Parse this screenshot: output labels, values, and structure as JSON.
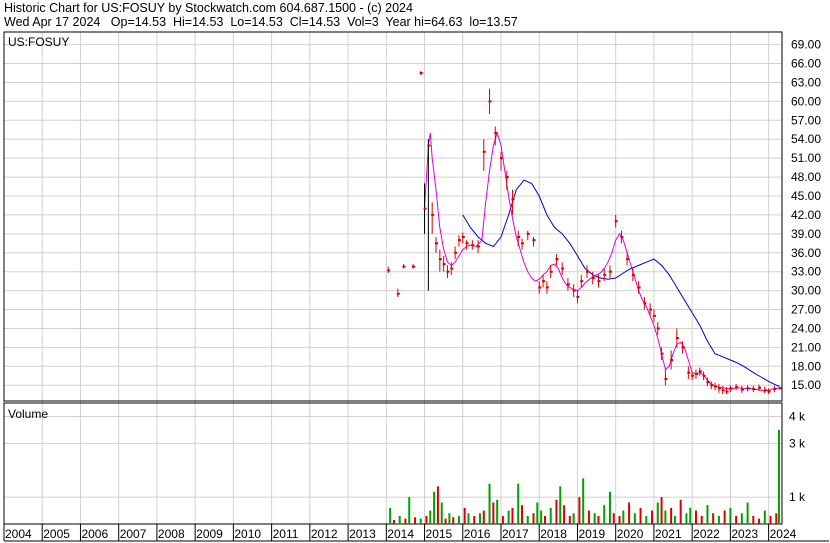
{
  "header": {
    "line1": "Historic Chart for US:FOSUY by Stockwatch.com 604.687.1500 - (c) 2024",
    "line2": "Wed Apr 17 2024   Op=14.53  Hi=14.53  Lo=14.53  Cl=14.53  Vol=3  Year hi=64.63  lo=13.57"
  },
  "colors": {
    "price_bar": "#dd0000",
    "ma_short": "#e000e0",
    "ma_long": "#0000cc",
    "vol_up": "#00a000",
    "vol_down": "#dd0000",
    "grid": "#d0d0d0"
  },
  "chart_data": [
    {
      "type": "line",
      "title": "US:FOSUY",
      "ylim": [
        12.5,
        71
      ],
      "ytick_labels": [
        "69.00",
        "66.00",
        "63.00",
        "60.00",
        "57.00",
        "54.00",
        "51.00",
        "48.00",
        "45.00",
        "42.00",
        "39.00",
        "36.00",
        "33.00",
        "30.00",
        "27.00",
        "24.00",
        "21.00",
        "18.00",
        "15.00"
      ],
      "x_labels": [
        "2004",
        "2005",
        "2006",
        "2007",
        "2008",
        "2009",
        "2010",
        "2011",
        "2012",
        "2013",
        "2014",
        "2015",
        "2016",
        "2017",
        "2018",
        "2019",
        "2020",
        "2021",
        "2022",
        "2023",
        "2024"
      ],
      "price": {
        "t": [
          2014.05,
          2014.3,
          2014.45,
          2014.7,
          2014.9,
          2015.0,
          2015.1,
          2015.2,
          2015.3,
          2015.4,
          2015.5,
          2015.6,
          2015.7,
          2015.8,
          2015.9,
          2016.0,
          2016.1,
          2016.25,
          2016.4,
          2016.55,
          2016.7,
          2016.85,
          2017.0,
          2017.15,
          2017.3,
          2017.45,
          2017.55,
          2017.7,
          2017.85,
          2018.0,
          2018.1,
          2018.2,
          2018.3,
          2018.45,
          2018.6,
          2018.75,
          2018.9,
          2019.0,
          2019.1,
          2019.25,
          2019.4,
          2019.55,
          2019.7,
          2019.85,
          2020.0,
          2020.15,
          2020.3,
          2020.45,
          2020.6,
          2020.75,
          2020.9,
          2021.0,
          2021.1,
          2021.2,
          2021.3,
          2021.45,
          2021.6,
          2021.75,
          2021.9,
          2022.0,
          2022.1,
          2022.2,
          2022.3,
          2022.4,
          2022.5,
          2022.6,
          2022.7,
          2022.8,
          2022.9,
          2023.0,
          2023.15,
          2023.3,
          2023.45,
          2023.6,
          2023.75,
          2023.9,
          2024.0,
          2024.15,
          2024.29
        ],
        "close": [
          33.2,
          29.5,
          33.8,
          33.8,
          64.5,
          43.0,
          53.0,
          42.0,
          37.5,
          35.0,
          34.2,
          33.0,
          33.5,
          36.0,
          38.0,
          38.5,
          37.5,
          37.2,
          37.0,
          52.0,
          60.0,
          55.0,
          51.0,
          48.0,
          44.5,
          38.5,
          37.5,
          39.0,
          38.0,
          30.5,
          31.5,
          30.5,
          33.0,
          35.0,
          33.5,
          31.0,
          30.0,
          29.0,
          31.5,
          33.0,
          32.0,
          31.5,
          32.5,
          33.0,
          41.0,
          38.5,
          35.0,
          32.5,
          30.5,
          28.0,
          27.0,
          26.0,
          24.0,
          20.0,
          16.0,
          19.0,
          22.5,
          21.0,
          17.0,
          16.5,
          16.8,
          17.2,
          16.5,
          15.5,
          15.0,
          14.8,
          14.5,
          14.2,
          14.0,
          14.5,
          14.7,
          14.3,
          14.5,
          14.4,
          14.6,
          14.2,
          14.0,
          14.4,
          14.53
        ],
        "high": [
          33.8,
          30.3,
          34.2,
          34.2,
          64.8,
          47.0,
          54.0,
          44.0,
          38.5,
          36.5,
          35.5,
          34.0,
          34.5,
          37.0,
          38.8,
          39.2,
          38.0,
          38.0,
          38.0,
          54.0,
          62.0,
          56.0,
          52.0,
          49.0,
          46.0,
          39.5,
          38.2,
          39.5,
          38.5,
          31.5,
          32.5,
          31.5,
          34.0,
          35.8,
          34.5,
          32.0,
          31.0,
          30.0,
          32.5,
          34.0,
          33.0,
          32.5,
          33.5,
          34.0,
          42.0,
          39.5,
          36.0,
          33.5,
          31.5,
          29.0,
          28.0,
          27.0,
          25.0,
          21.0,
          17.5,
          20.5,
          24.0,
          22.0,
          18.0,
          17.2,
          17.5,
          17.8,
          17.2,
          16.2,
          15.6,
          15.4,
          15.2,
          14.9,
          14.7,
          15.0,
          15.2,
          14.9,
          15.0,
          14.9,
          15.1,
          14.8,
          14.5,
          14.9,
          14.53
        ],
        "low": [
          32.8,
          29.0,
          33.5,
          33.5,
          64.2,
          39.0,
          30.0,
          39.0,
          36.0,
          33.0,
          33.0,
          32.0,
          32.5,
          35.0,
          37.0,
          37.5,
          36.5,
          36.5,
          36.0,
          49.0,
          58.0,
          53.0,
          49.0,
          46.0,
          42.0,
          37.0,
          36.5,
          38.0,
          37.0,
          29.5,
          30.5,
          29.5,
          32.0,
          34.0,
          32.5,
          30.0,
          29.0,
          28.0,
          30.5,
          32.0,
          31.0,
          30.5,
          31.5,
          32.0,
          40.0,
          37.5,
          34.0,
          31.5,
          29.5,
          27.0,
          26.0,
          25.0,
          23.0,
          19.0,
          15.0,
          17.5,
          21.0,
          20.0,
          16.0,
          15.8,
          16.0,
          16.5,
          15.8,
          14.9,
          14.4,
          14.2,
          13.8,
          13.6,
          13.57,
          13.9,
          14.2,
          13.8,
          14.0,
          13.9,
          14.1,
          13.7,
          13.6,
          13.9,
          14.53
        ]
      },
      "ma_short": {
        "t": [
          2015.0,
          2015.1,
          2015.15,
          2015.2,
          2015.3,
          2015.4,
          2015.5,
          2015.6,
          2015.7,
          2015.8,
          2015.9,
          2016.0,
          2016.1,
          2016.2,
          2016.35,
          2016.5,
          2016.6,
          2016.7,
          2016.8,
          2016.9,
          2017.0,
          2017.1,
          2017.2,
          2017.3,
          2017.4,
          2017.5,
          2017.6,
          2017.7,
          2017.8,
          2017.9,
          2018.0,
          2018.1,
          2018.2,
          2018.3,
          2018.4,
          2018.5,
          2018.6,
          2018.7,
          2018.8,
          2018.9,
          2019.0,
          2019.1,
          2019.2,
          2019.35,
          2019.5,
          2019.6,
          2019.7,
          2019.8,
          2019.9,
          2020.0,
          2020.1,
          2020.2,
          2020.35,
          2020.5,
          2020.6,
          2020.7,
          2020.8,
          2020.9,
          2021.0,
          2021.1,
          2021.2,
          2021.3,
          2021.4,
          2021.5,
          2021.6,
          2021.7,
          2021.8,
          2021.9,
          2022.0,
          2022.1,
          2022.2,
          2022.3,
          2022.4,
          2022.5,
          2022.6,
          2022.7,
          2022.8,
          2022.9,
          2023.0,
          2023.1,
          2023.2,
          2023.3,
          2023.4,
          2023.5,
          2023.6,
          2023.7,
          2023.8,
          2023.9,
          2024.0,
          2024.1,
          2024.2,
          2024.29
        ],
        "values": [
          43.0,
          53.0,
          55.0,
          51.0,
          46.0,
          40.0,
          36.5,
          34.5,
          34.0,
          34.5,
          35.5,
          36.5,
          37.0,
          37.2,
          37.0,
          38.0,
          44.0,
          49.0,
          53.0,
          55.0,
          53.0,
          49.0,
          45.0,
          41.5,
          38.5,
          36.5,
          34.5,
          33.0,
          32.0,
          31.5,
          31.8,
          32.5,
          33.0,
          34.0,
          34.2,
          33.5,
          32.0,
          31.0,
          30.5,
          30.2,
          30.0,
          30.5,
          31.2,
          32.0,
          32.5,
          32.8,
          33.5,
          34.5,
          36.0,
          38.0,
          39.0,
          38.0,
          35.0,
          32.0,
          30.0,
          28.5,
          27.5,
          26.0,
          24.5,
          22.5,
          20.0,
          17.5,
          18.0,
          20.0,
          21.5,
          21.8,
          21.0,
          19.0,
          17.0,
          16.8,
          17.0,
          16.6,
          15.8,
          15.2,
          14.9,
          14.7,
          14.6,
          14.5,
          14.4,
          14.5,
          14.6,
          14.5,
          14.5,
          14.5,
          14.4,
          14.3,
          14.2,
          14.1,
          14.2,
          14.4,
          14.5,
          14.53
        ]
      },
      "ma_long": {
        "t": [
          2016.0,
          2016.2,
          2016.4,
          2016.6,
          2016.8,
          2017.0,
          2017.2,
          2017.4,
          2017.6,
          2017.8,
          2018.0,
          2018.2,
          2018.4,
          2018.6,
          2018.8,
          2019.0,
          2019.2,
          2019.4,
          2019.6,
          2019.8,
          2020.0,
          2020.2,
          2020.4,
          2020.6,
          2020.8,
          2021.0,
          2021.2,
          2021.4,
          2021.6,
          2021.8,
          2022.0,
          2022.2,
          2022.4,
          2022.6,
          2022.8,
          2023.0,
          2023.2,
          2023.4,
          2023.6,
          2023.8,
          2024.0,
          2024.2,
          2024.29
        ],
        "values": [
          42.0,
          40.0,
          38.5,
          37.5,
          37.0,
          38.5,
          42.0,
          46.0,
          47.5,
          47.0,
          45.0,
          42.0,
          40.0,
          39.0,
          37.5,
          35.5,
          33.5,
          32.5,
          32.0,
          31.8,
          32.0,
          32.8,
          33.5,
          34.0,
          34.5,
          35.0,
          34.0,
          32.5,
          30.5,
          28.5,
          26.5,
          24.5,
          22.0,
          20.0,
          19.5,
          19.0,
          18.5,
          17.8,
          17.0,
          16.3,
          15.6,
          15.0,
          14.8
        ]
      }
    },
    {
      "type": "bar",
      "title": "Volume",
      "ylim": [
        0,
        4500
      ],
      "ytick_labels": [
        "4 k",
        "3 k",
        "1 k"
      ],
      "t": [
        2014.1,
        2014.2,
        2014.35,
        2014.5,
        2014.6,
        2014.75,
        2014.9,
        2015.05,
        2015.15,
        2015.25,
        2015.35,
        2015.45,
        2015.55,
        2015.65,
        2015.75,
        2015.9,
        2016.05,
        2016.15,
        2016.3,
        2016.45,
        2016.55,
        2016.7,
        2016.8,
        2016.9,
        2017.05,
        2017.2,
        2017.3,
        2017.45,
        2017.55,
        2017.7,
        2017.85,
        2017.95,
        2018.05,
        2018.15,
        2018.3,
        2018.45,
        2018.55,
        2018.65,
        2018.8,
        2018.9,
        2019.05,
        2019.15,
        2019.3,
        2019.45,
        2019.55,
        2019.7,
        2019.85,
        2019.95,
        2020.1,
        2020.2,
        2020.35,
        2020.5,
        2020.65,
        2020.8,
        2020.95,
        2021.1,
        2021.2,
        2021.3,
        2021.45,
        2021.55,
        2021.7,
        2021.85,
        2021.95,
        2022.1,
        2022.25,
        2022.4,
        2022.55,
        2022.7,
        2022.85,
        2023.0,
        2023.15,
        2023.3,
        2023.45,
        2023.6,
        2023.75,
        2023.9,
        2024.05,
        2024.2,
        2024.27
      ],
      "values": [
        600,
        150,
        300,
        200,
        1000,
        250,
        200,
        300,
        500,
        1200,
        1400,
        800,
        200,
        400,
        250,
        300,
        600,
        400,
        300,
        400,
        500,
        1500,
        800,
        900,
        300,
        500,
        600,
        1500,
        700,
        300,
        400,
        800,
        500,
        300,
        600,
        900,
        1400,
        700,
        300,
        400,
        1000,
        1700,
        500,
        400,
        300,
        700,
        1200,
        400,
        300,
        500,
        800,
        400,
        600,
        300,
        500,
        800,
        1000,
        500,
        600,
        300,
        900,
        400,
        600,
        500,
        300,
        700,
        400,
        300,
        500,
        600,
        300,
        400,
        800,
        300,
        200,
        500,
        300,
        400,
        3500
      ],
      "up": [
        true,
        false,
        true,
        false,
        true,
        false,
        true,
        false,
        true,
        true,
        false,
        true,
        false,
        true,
        false,
        true,
        false,
        true,
        false,
        true,
        false,
        true,
        false,
        true,
        false,
        true,
        false,
        true,
        false,
        true,
        false,
        true,
        true,
        false,
        true,
        false,
        true,
        false,
        false,
        true,
        false,
        true,
        false,
        true,
        false,
        true,
        true,
        false,
        false,
        true,
        false,
        true,
        false,
        true,
        false,
        true,
        false,
        true,
        false,
        true,
        false,
        true,
        true,
        false,
        false,
        true,
        false,
        true,
        false,
        true,
        false,
        true,
        true,
        false,
        false,
        true,
        false,
        false,
        true
      ]
    }
  ]
}
